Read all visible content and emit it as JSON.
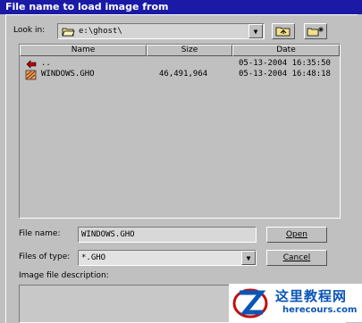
{
  "window": {
    "title": "File name to load image from"
  },
  "look_in": {
    "label": "Look in:",
    "path": "e:\\ghost\\"
  },
  "columns": [
    "Name",
    "Size",
    "Date"
  ],
  "files": [
    {
      "name": "..",
      "size": "",
      "date": "05-13-2004 16:35:50",
      "icon": "parent-folder-icon"
    },
    {
      "name": "WINDOWS.GHO",
      "size": "46,491,964",
      "date": "05-13-2004 16:48:18",
      "icon": "ghost-image-file-icon"
    }
  ],
  "file_name": {
    "label": "File name:",
    "value": "WINDOWS.GHO"
  },
  "files_of_type": {
    "label": "Files of type:",
    "value": "*.GHO"
  },
  "description": {
    "label": "Image file description:",
    "value": ""
  },
  "buttons": {
    "open": "Open",
    "cancel": "Cancel"
  },
  "watermark": {
    "title": "这里教程网",
    "url": "herecours.com"
  },
  "colors": {
    "title_bar": "#1a1aa6",
    "dialog": "#c0c0c0",
    "watermark_blue": "#0a55b8"
  }
}
